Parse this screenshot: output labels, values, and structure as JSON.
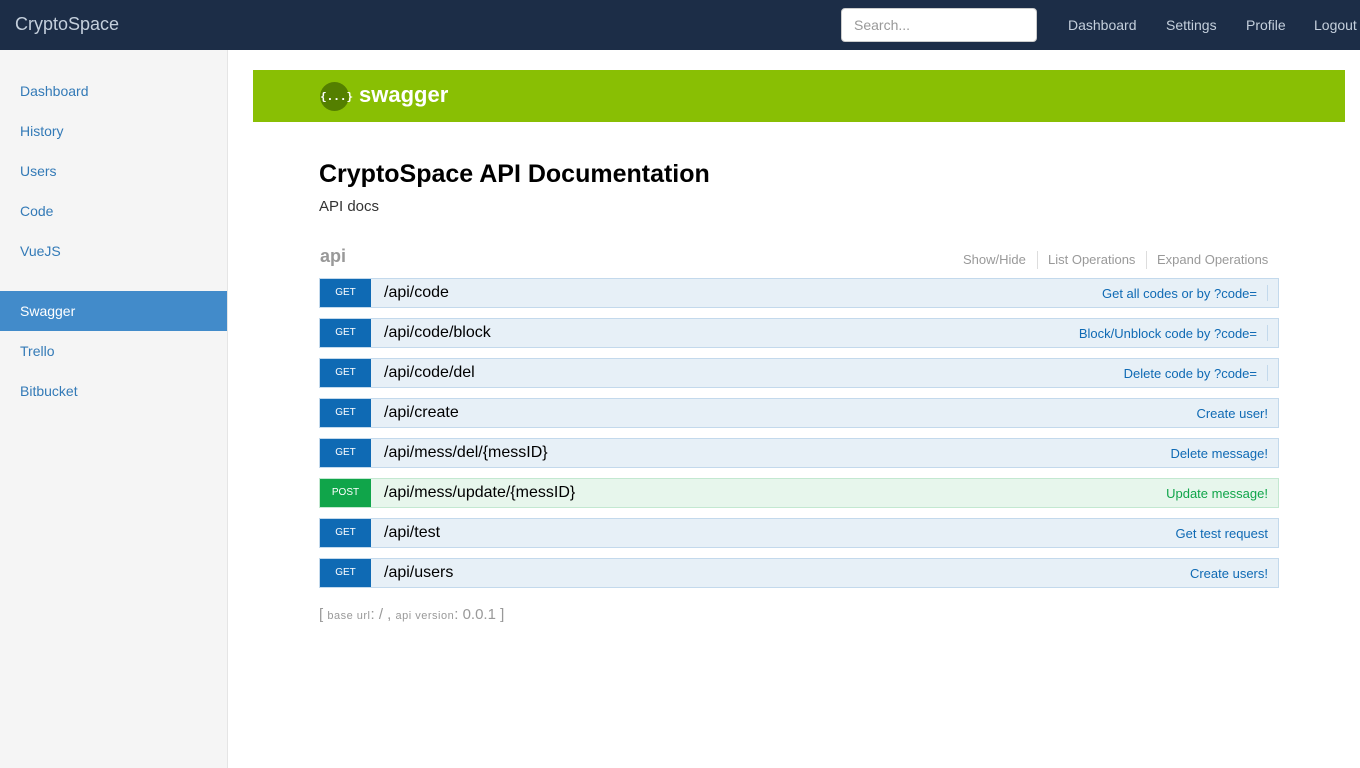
{
  "navbar": {
    "brand": "CryptoSpace",
    "search_placeholder": "Search...",
    "links": [
      "Dashboard",
      "Settings",
      "Profile",
      "Logout"
    ]
  },
  "sidebar": {
    "items": [
      {
        "label": "Dashboard",
        "active": false
      },
      {
        "label": "History",
        "active": false
      },
      {
        "label": "Users",
        "active": false
      },
      {
        "label": "Code",
        "active": false
      },
      {
        "label": "VueJS",
        "active": false
      },
      {
        "label": "Swagger",
        "active": true
      },
      {
        "label": "Trello",
        "active": false
      },
      {
        "label": "Bitbucket",
        "active": false
      }
    ]
  },
  "swagger": {
    "logo_glyph": "{...}",
    "logo_text": "swagger",
    "title": "CryptoSpace API Documentation",
    "description": "API docs",
    "group": {
      "name": "api",
      "links": [
        "Show/Hide",
        "List Operations",
        "Expand Operations"
      ]
    },
    "operations": [
      {
        "method": "GET",
        "path": "/api/code",
        "summary": "Get all codes or by ?code="
      },
      {
        "method": "GET",
        "path": "/api/code/block",
        "summary": "Block/Unblock code by ?code="
      },
      {
        "method": "GET",
        "path": "/api/code/del",
        "summary": "Delete code by ?code="
      },
      {
        "method": "GET",
        "path": "/api/create",
        "summary": "Create user!"
      },
      {
        "method": "GET",
        "path": "/api/mess/del/{messID}",
        "summary": "Delete message!"
      },
      {
        "method": "POST",
        "path": "/api/mess/update/{messID}",
        "summary": "Update message!"
      },
      {
        "method": "GET",
        "path": "/api/test",
        "summary": "Get test request"
      },
      {
        "method": "GET",
        "path": "/api/users",
        "summary": "Create users!"
      }
    ],
    "footer": {
      "open_bracket": "[",
      "base_url_label": "base url",
      "base_url_value": "/",
      "separator": ",",
      "api_version_label": "api version",
      "api_version_value": "0.0.1",
      "close_bracket": "]"
    }
  },
  "colors": {
    "navbar_bg": "#1c2d47",
    "swagger_green": "#89bf04",
    "get_blue": "#0f6ab4",
    "post_green": "#10a54a",
    "sidebar_active": "#428bca"
  }
}
